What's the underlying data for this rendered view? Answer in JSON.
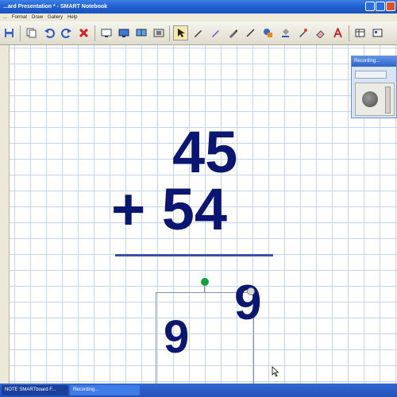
{
  "window": {
    "title": "...ard Presentation * - SMART Notebook"
  },
  "menu": {
    "items": [
      "...",
      "Format",
      "Draw",
      "Gallery",
      "Help"
    ]
  },
  "toolbar": {
    "icons": [
      "floppy-icon",
      "duplicate-icon",
      "undo-icon",
      "redo-icon",
      "delete-icon",
      "screen-shade-icon",
      "full-screen-icon",
      "dual-page-icon",
      "capture-icon",
      "select-icon",
      "pen-icon",
      "creative-pen-icon",
      "highlighter-icon",
      "line-icon",
      "shapes-icon",
      "fill-icon",
      "magic-pen-icon",
      "eraser-icon",
      "text-icon",
      "table-icon",
      "properties-icon"
    ]
  },
  "canvas": {
    "top_number": "45",
    "bottom_number": "+ 54",
    "answer_tens": "9",
    "answer_ones": "9",
    "colors": {
      "ink": "#0b1670",
      "grid": "#c4d4ea",
      "handle": "#13a23a"
    }
  },
  "recorder": {
    "title": "Recording..."
  },
  "taskbar": {
    "items": [
      "NOTE SMARTboard F...",
      "Recording..."
    ]
  }
}
